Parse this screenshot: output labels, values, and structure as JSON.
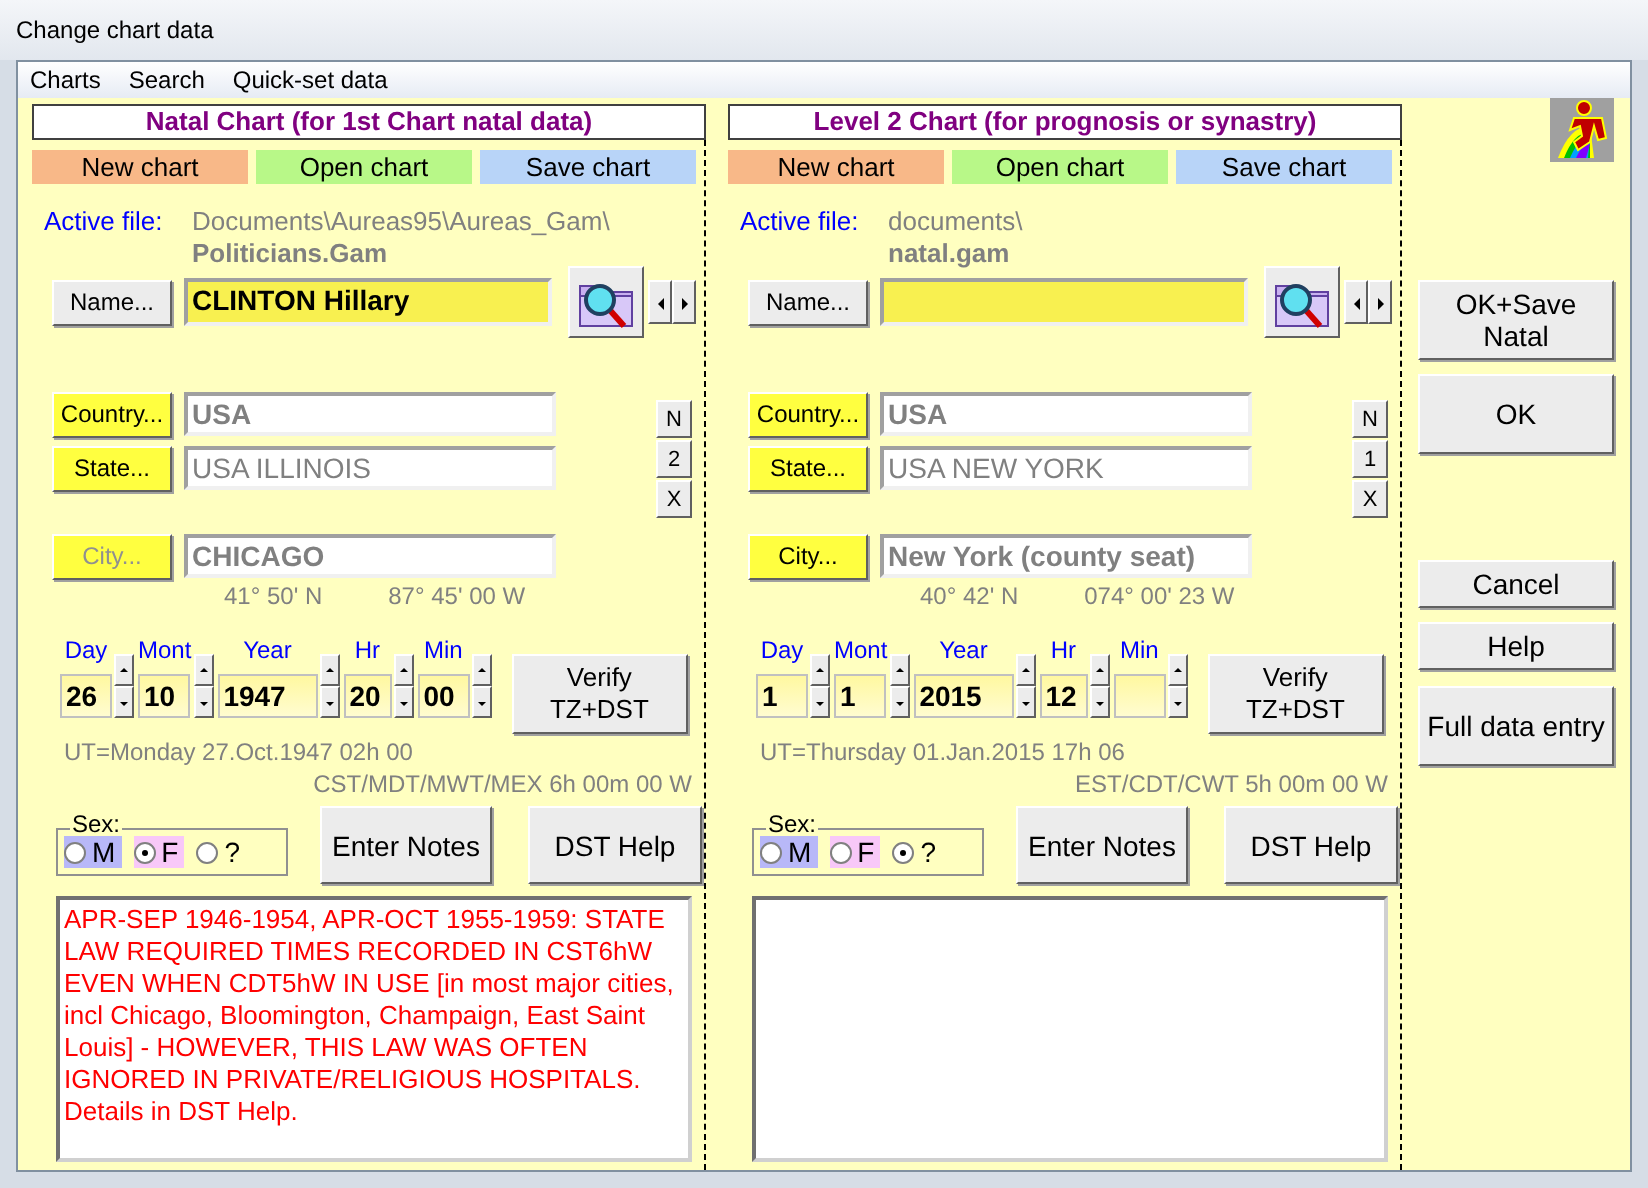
{
  "window": {
    "title": "Change chart data"
  },
  "menu": [
    "Charts",
    "Search",
    "Quick-set data"
  ],
  "panels": [
    {
      "title": "Natal Chart (for 1st Chart natal data)",
      "file_buttons": [
        {
          "label": "New chart",
          "color": "#f8b888"
        },
        {
          "label": "Open chart",
          "color": "#b8f888"
        },
        {
          "label": "Save chart",
          "color": "#b8d4f8"
        }
      ],
      "active_file_label": "Active file:",
      "file_path": "Documents\\Aureas95\\Aureas_Gam\\",
      "file_name": "Politicians.Gam",
      "name_button": "Name...",
      "name_value": "CLINTON Hillary",
      "country_button": "Country...",
      "country_value": "USA",
      "state_button": "State...",
      "state_value": "USA ILLINOIS",
      "city_button": {
        "label": "City...",
        "disabled": true
      },
      "city_value": "CHICAGO",
      "side_buttons": [
        "N",
        "2",
        "X"
      ],
      "latitude": "41° 50' N",
      "longitude": "87° 45' 00 W",
      "date_fields": [
        {
          "label": "Day",
          "value": "26"
        },
        {
          "label": "Mont",
          "value": "10"
        },
        {
          "label": "Year",
          "value": "1947"
        },
        {
          "label": "Hr",
          "value": "20"
        },
        {
          "label": "Min",
          "value": "00"
        }
      ],
      "verify_button": "Verify\nTZ+DST",
      "ut_text": "UT=Monday 27.Oct.1947 02h 00",
      "timezone": "CST/MDT/MWT/MEX 6h 00m 00 W",
      "sex_label": "Sex:",
      "sex_options": [
        {
          "label": "M",
          "selected": false,
          "color": "#b8b8f8"
        },
        {
          "label": "F",
          "selected": true,
          "color": "#f8c8f8"
        },
        {
          "label": "?",
          "selected": false
        }
      ],
      "notes_button": "Enter Notes",
      "dst_help_button": "DST Help",
      "notes": "APR-SEP 1946-1954, APR-OCT 1955-1959: STATE LAW REQUIRED TIMES RECORDED IN CST6hW EVEN WHEN CDT5hW IN USE [in most major cities, incl Chicago, Bloomington, Champaign, East Saint Louis] - HOWEVER, THIS LAW WAS OFTEN IGNORED IN PRIVATE/RELIGIOUS HOSPITALS. Details in DST Help."
    },
    {
      "title": "Level 2 Chart (for prognosis or synastry)",
      "file_buttons": [
        {
          "label": "New chart",
          "color": "#f8b888"
        },
        {
          "label": "Open chart",
          "color": "#b8f888"
        },
        {
          "label": "Save chart",
          "color": "#b8d4f8"
        }
      ],
      "active_file_label": "Active file:",
      "file_path": "documents\\",
      "file_name": "natal.gam",
      "name_button": "Name...",
      "country_button": "Country...",
      "country_value": "USA",
      "state_button": "State...",
      "state_value": "USA NEW YORK",
      "city_button": {
        "label": "City...",
        "disabled": false
      },
      "city_value": "New York (county seat)",
      "side_buttons": [
        "N",
        "1",
        "X"
      ],
      "latitude": "40° 42' N",
      "longitude": "074° 00' 23 W",
      "date_fields": [
        {
          "label": "Day",
          "value": "1"
        },
        {
          "label": "Mont",
          "value": "1"
        },
        {
          "label": "Year",
          "value": "2015"
        },
        {
          "label": "Hr",
          "value": "12"
        },
        {
          "label": "Min"
        }
      ],
      "verify_button": "Verify\nTZ+DST",
      "ut_text": "UT=Thursday 01.Jan.2015 17h 06",
      "timezone": "EST/CDT/CWT 5h 00m 00 W",
      "sex_label": "Sex:",
      "sex_options": [
        {
          "label": "M",
          "selected": false,
          "color": "#b8b8f8"
        },
        {
          "label": "F",
          "selected": false,
          "color": "#f8c8f8"
        },
        {
          "label": "?",
          "selected": true
        }
      ],
      "notes_button": "Enter Notes",
      "dst_help_button": "DST Help"
    }
  ],
  "action_buttons": [
    {
      "label": "OK+Save Natal",
      "kind": "large"
    },
    {
      "label": "OK",
      "kind": "large"
    },
    {
      "label": "Cancel",
      "kind": "small"
    },
    {
      "label": "Help",
      "kind": "small"
    },
    {
      "label": "Full data entry",
      "kind": "large"
    }
  ]
}
